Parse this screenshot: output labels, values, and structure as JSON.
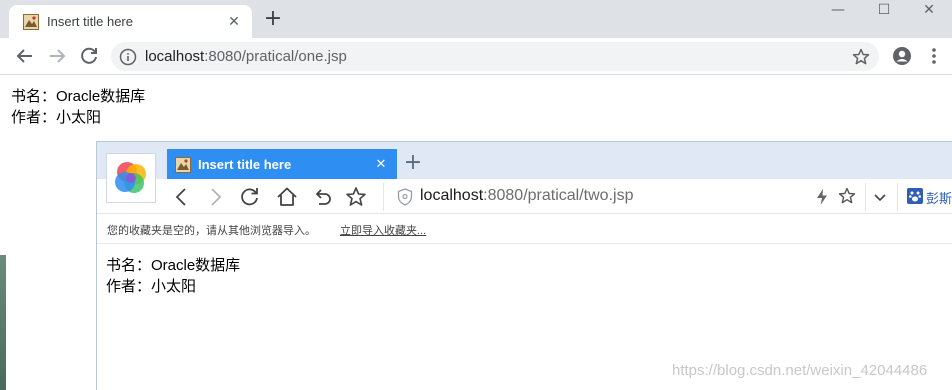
{
  "window1": {
    "tab": {
      "title": "Insert title here",
      "close": "✕"
    },
    "new_tab": "+",
    "window_controls": {
      "minimize": "—",
      "maximize": "☐",
      "close": "✕"
    },
    "address": {
      "host": "localhost",
      "path": ":8080/pratical/one.jsp"
    },
    "content": {
      "line1": "书名：Oracle数据库",
      "line2": "作者：小太阳"
    }
  },
  "window2": {
    "tab": {
      "title": "Insert title here",
      "close": "✕"
    },
    "new_tab": "+",
    "address": {
      "host": "localhost",
      "path": ":8080/pratical/two.jsp"
    },
    "search_engine_label": "彭斯",
    "bookmarks_bar": {
      "message": "您的收藏夹是空的，请从其他浏览器导入。",
      "import_link": "立即导入收藏夹..."
    },
    "content": {
      "line1": "书名：Oracle数据库",
      "line2": "作者：小太阳"
    },
    "accent_color": "#2f8ef2"
  },
  "watermark": "https://blog.csdn.net/weixin_42044486"
}
